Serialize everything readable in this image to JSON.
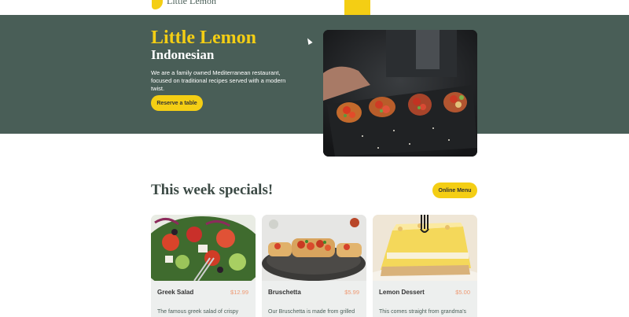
{
  "brand": {
    "logo_text": "Little Lemon",
    "yellow": "#F4CE14",
    "green": "#495E57",
    "salmon": "#EE9972"
  },
  "hero": {
    "title": "Little Lemon",
    "subtitle": "Indonesian",
    "description": "We are a family owned Mediterranean restaurant, focused on traditional recipes served with a modern twist.",
    "reserve_label": "Reserve a table",
    "photo_icon": "bruschetta-platter-photo"
  },
  "specials": {
    "title": "This week specials!",
    "online_menu_label": "Online Menu",
    "cards": [
      {
        "name": "Greek Salad",
        "price": "$12.99",
        "description": "The famous greek salad of crispy",
        "photo_icon": "greek-salad-photo"
      },
      {
        "name": "Bruschetta",
        "price": "$5.99",
        "description": "Our Bruschetta is made from grilled",
        "photo_icon": "bruschetta-photo"
      },
      {
        "name": "Lemon Dessert",
        "price": "$5.00",
        "description": "This comes straight from grandma's",
        "photo_icon": "lemon-dessert-photo"
      }
    ]
  }
}
